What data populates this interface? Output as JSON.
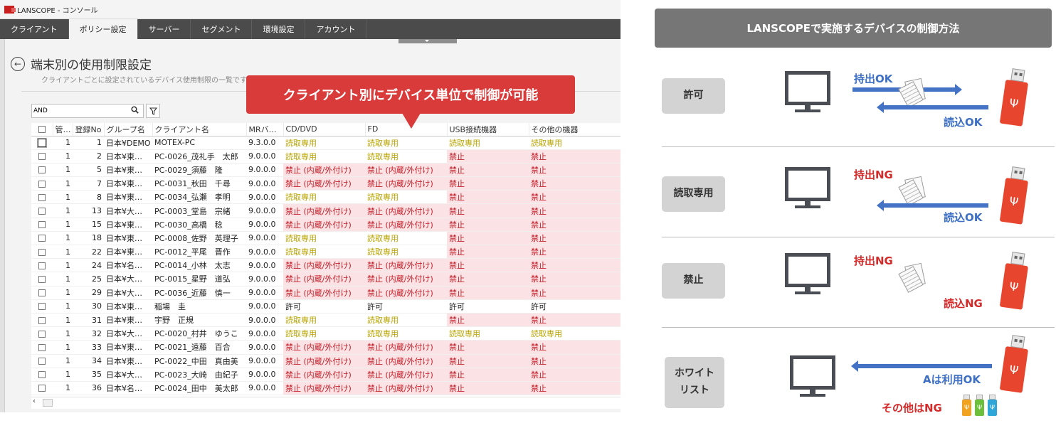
{
  "window": {
    "title": "LANSCOPE - コンソール"
  },
  "nav": {
    "tabs": [
      {
        "label": "クライアント",
        "active": false
      },
      {
        "label": "ポリシー設定",
        "active": true
      },
      {
        "label": "サーバー",
        "active": false
      },
      {
        "label": "セグメント",
        "active": false
      },
      {
        "label": "環境設定",
        "active": false
      },
      {
        "label": "アカウント",
        "active": false
      }
    ]
  },
  "page": {
    "title": "端末別の使用制限設定",
    "subtitle": "クライアントごとに設定されているデバイス使用制限の一覧です。"
  },
  "callout": {
    "text": "クライアント別にデバイス単位で制御が可能"
  },
  "filter": {
    "value": "AND",
    "placeholder": ""
  },
  "table": {
    "columns": [
      "管…",
      "登録No",
      "グループ名",
      "クライアント名",
      "MRバ…",
      "CD/DVD",
      "FD",
      "USB接続機器",
      "その他の機器"
    ],
    "rows": [
      {
        "kan": "1",
        "no": "1",
        "group": "日本¥DEMO",
        "client": "MOTEX-PC",
        "mr": "9.3.0.0",
        "cd": "読取専用",
        "fd": "読取専用",
        "usb": "読取専用",
        "other": "読取専用"
      },
      {
        "kan": "1",
        "no": "2",
        "group": "日本¥東…",
        "client": "PC-0026_茂礼手　太郎",
        "mr": "9.0.0.0",
        "cd": "読取専用",
        "fd": "読取専用",
        "usb": "禁止",
        "other": "禁止"
      },
      {
        "kan": "1",
        "no": "5",
        "group": "日本¥東…",
        "client": "PC-0029_須藤　隆",
        "mr": "9.0.0.0",
        "cd": "禁止 (内蔵/外付け)",
        "fd": "禁止 (内蔵/外付け)",
        "usb": "禁止",
        "other": "禁止"
      },
      {
        "kan": "1",
        "no": "7",
        "group": "日本¥東…",
        "client": "PC-0031_秋田　千尋",
        "mr": "9.0.0.0",
        "cd": "禁止 (内蔵/外付け)",
        "fd": "禁止 (内蔵/外付け)",
        "usb": "禁止",
        "other": "禁止"
      },
      {
        "kan": "1",
        "no": "8",
        "group": "日本¥東…",
        "client": "PC-0034_弘瀬　孝明",
        "mr": "9.0.0.0",
        "cd": "読取専用",
        "fd": "読取専用",
        "usb": "禁止",
        "other": "禁止"
      },
      {
        "kan": "1",
        "no": "13",
        "group": "日本¥大…",
        "client": "PC-0003_堂島　宗緒",
        "mr": "9.0.0.0",
        "cd": "禁止 (内蔵/外付け)",
        "fd": "禁止 (内蔵/外付け)",
        "usb": "禁止",
        "other": "禁止"
      },
      {
        "kan": "1",
        "no": "15",
        "group": "日本¥東…",
        "client": "PC-0030_高橋　稔",
        "mr": "9.0.0.0",
        "cd": "禁止 (内蔵/外付け)",
        "fd": "禁止 (内蔵/外付け)",
        "usb": "禁止",
        "other": "禁止"
      },
      {
        "kan": "1",
        "no": "18",
        "group": "日本¥東…",
        "client": "PC-0008_佐野　英理子",
        "mr": "9.0.0.0",
        "cd": "読取専用",
        "fd": "読取専用",
        "usb": "禁止",
        "other": "禁止"
      },
      {
        "kan": "1",
        "no": "22",
        "group": "日本¥東…",
        "client": "PC-0012_平尾　晋作",
        "mr": "9.0.0.0",
        "cd": "読取専用",
        "fd": "読取専用",
        "usb": "禁止",
        "other": "禁止"
      },
      {
        "kan": "1",
        "no": "24",
        "group": "日本¥名…",
        "client": "PC-0014_小林　太志",
        "mr": "9.0.0.0",
        "cd": "禁止 (内蔵/外付け)",
        "fd": "禁止 (内蔵/外付け)",
        "usb": "禁止",
        "other": "禁止"
      },
      {
        "kan": "1",
        "no": "25",
        "group": "日本¥大…",
        "client": "PC-0015_星野　道弘",
        "mr": "9.0.0.0",
        "cd": "禁止 (内蔵/外付け)",
        "fd": "禁止 (内蔵/外付け)",
        "usb": "禁止",
        "other": "禁止"
      },
      {
        "kan": "1",
        "no": "29",
        "group": "日本¥大…",
        "client": "PC-0036_近藤　慎一",
        "mr": "9.0.0.0",
        "cd": "禁止 (内蔵/外付け)",
        "fd": "禁止 (内蔵/外付け)",
        "usb": "禁止",
        "other": "禁止"
      },
      {
        "kan": "1",
        "no": "30",
        "group": "日本¥東…",
        "client": "稲場　圭",
        "mr": "9.0.0.0",
        "cd": "許可",
        "fd": "許可",
        "usb": "許可",
        "other": "許可"
      },
      {
        "kan": "1",
        "no": "31",
        "group": "日本¥東…",
        "client": "宇野　正規",
        "mr": "9.0.0.0",
        "cd": "読取専用",
        "fd": "読取専用",
        "usb": "禁止",
        "other": "禁止"
      },
      {
        "kan": "1",
        "no": "32",
        "group": "日本¥大…",
        "client": "PC-0020_村井　ゆうこ",
        "mr": "9.0.0.0",
        "cd": "読取専用",
        "fd": "読取専用",
        "usb": "読取専用",
        "other": "読取専用"
      },
      {
        "kan": "1",
        "no": "33",
        "group": "日本¥東…",
        "client": "PC-0021_遠藤　百合",
        "mr": "9.0.0.0",
        "cd": "禁止 (内蔵/外付け)",
        "fd": "禁止 (内蔵/外付け)",
        "usb": "禁止",
        "other": "禁止"
      },
      {
        "kan": "1",
        "no": "34",
        "group": "日本¥東…",
        "client": "PC-0022_中田　真由美",
        "mr": "9.0.0.0",
        "cd": "禁止 (内蔵/外付け)",
        "fd": "禁止 (内蔵/外付け)",
        "usb": "禁止",
        "other": "禁止"
      },
      {
        "kan": "1",
        "no": "35",
        "group": "日本¥大…",
        "client": "PC-0023_大崎　由紀子",
        "mr": "9.0.0.0",
        "cd": "禁止 (内蔵/外付け)",
        "fd": "禁止 (内蔵/外付け)",
        "usb": "禁止",
        "other": "禁止"
      },
      {
        "kan": "1",
        "no": "36",
        "group": "日本¥名…",
        "client": "PC-0024_田中　美太郎",
        "mr": "9.0.0.0",
        "cd": "禁止 (内蔵/外付け)",
        "fd": "禁止 (内蔵/外付け)",
        "usb": "禁止",
        "other": "禁止"
      }
    ]
  },
  "diagram": {
    "title": "LANSCOPEで実施するデバイスの制御方法",
    "sections": [
      {
        "label": "許可",
        "out_label": "持出OK",
        "in_label": "読込OK"
      },
      {
        "label": "読取専用",
        "out_label": "持出NG",
        "in_label": "読込OK"
      },
      {
        "label": "禁止",
        "out_label": "持出NG",
        "in_label": "読込NG"
      },
      {
        "label_line1": "ホワイト",
        "label_line2": "リスト",
        "in_label": "Aは利用OK",
        "other_label": "その他はNG"
      }
    ]
  },
  "colors": {
    "accent_red": "#d93a3a",
    "nav_dark": "#4b4b4b",
    "denied_bg": "#fbe2e4",
    "denied_text": "#c4202a",
    "readonly_text": "#b9a400",
    "arrow_blue": "#4472c4",
    "usb_red": "#e8452f"
  },
  "icons": {
    "back": "arrow-left-circle-icon",
    "search": "search-icon",
    "filter": "funnel-icon",
    "usb_symbol": "usb-symbol-icon"
  }
}
